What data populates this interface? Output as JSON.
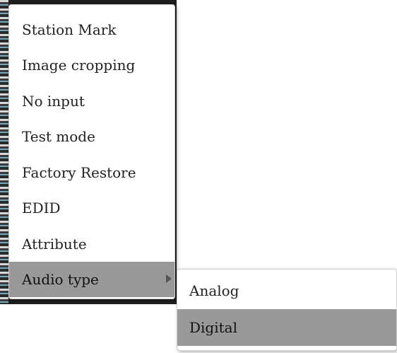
{
  "context_menu": {
    "items": [
      {
        "label": "Station Mark"
      },
      {
        "label": "Image cropping"
      },
      {
        "label": "No input"
      },
      {
        "label": "Test mode"
      },
      {
        "label": "Factory Restore"
      },
      {
        "label": "EDID"
      },
      {
        "label": "Attribute"
      },
      {
        "label": "Audio type",
        "has_submenu": true,
        "highlighted": true
      }
    ]
  },
  "audio_type_submenu": {
    "items": [
      {
        "label": "Analog"
      },
      {
        "label": "Digital",
        "highlighted": true
      }
    ]
  },
  "colors": {
    "highlight": "#999999",
    "menu_background": "#ffffff",
    "text": "#222222"
  }
}
